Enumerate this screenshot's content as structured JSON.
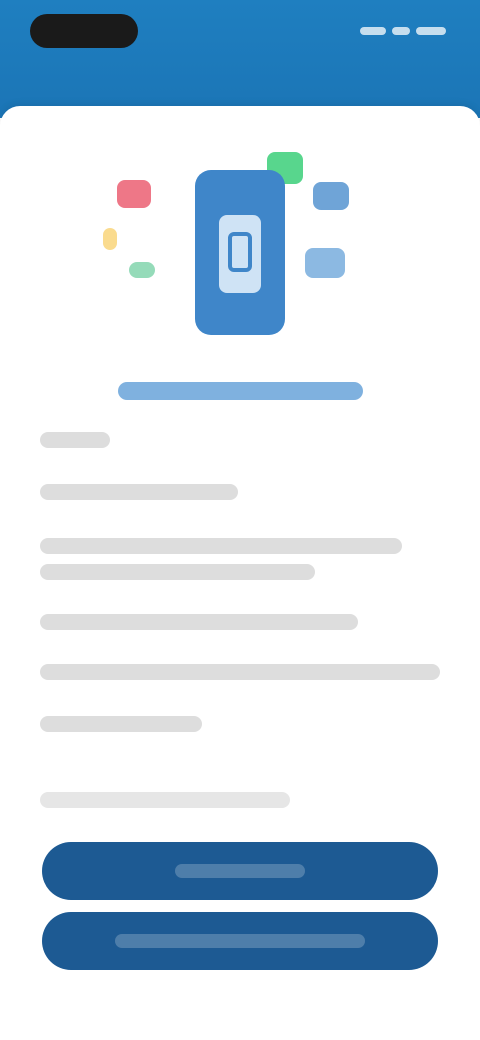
{
  "header": {
    "title": "",
    "status_label": ""
  },
  "illustration": {
    "icon": "phone-icon",
    "accent": "#3f86c9",
    "dot_colors": [
      "#e84a5f",
      "#f6c343",
      "#4fc38a",
      "#2ecc71",
      "#3f86c9",
      "#5b9bd5"
    ]
  },
  "content": {
    "heading": "",
    "lines": [
      "",
      "",
      "",
      "",
      "",
      "",
      ""
    ],
    "footer_note": ""
  },
  "buttons": {
    "primary_label": "",
    "secondary_label": ""
  }
}
